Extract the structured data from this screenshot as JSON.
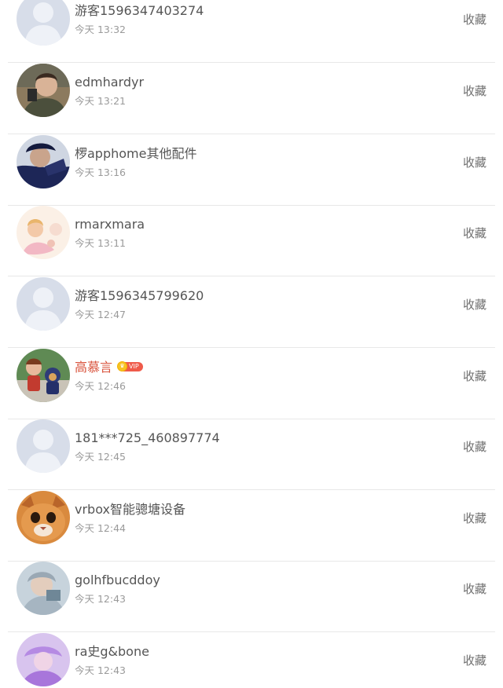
{
  "items": [
    {
      "name": "游客1596347403274",
      "time": "今天 13:32",
      "action": "收藏",
      "avatar": "default-avatar-icon"
    },
    {
      "name": "edmhardyr",
      "time": "今天 13:21",
      "action": "收藏",
      "avatar": "user-photo"
    },
    {
      "name": "椤apphome其他配件",
      "time": "今天 13:16",
      "action": "收藏",
      "avatar": "user-photo"
    },
    {
      "name": "rmarxmara",
      "time": "今天 13:11",
      "action": "收藏",
      "avatar": "user-photo"
    },
    {
      "name": "游客1596345799620",
      "time": "今天 12:47",
      "action": "收藏",
      "avatar": "default-avatar-icon"
    },
    {
      "name": "高慕言",
      "time": "今天 12:46",
      "action": "收藏",
      "avatar": "user-photo",
      "vip": "VIP"
    },
    {
      "name": "181***725_460897774",
      "time": "今天 12:45",
      "action": "收藏",
      "avatar": "default-avatar-icon"
    },
    {
      "name": "vrbox智能骢塘设备",
      "time": "今天 12:44",
      "action": "收藏",
      "avatar": "user-photo"
    },
    {
      "name": "golhfbucddoy",
      "time": "今天 12:43",
      "action": "收藏",
      "avatar": "user-photo"
    },
    {
      "name": "ra史g&bone",
      "time": "今天 12:43",
      "action": "收藏",
      "avatar": "user-photo"
    }
  ],
  "colors": {
    "name_text": "#555555",
    "vip_name_text": "#d9533c",
    "time_text": "#9a9a9a",
    "divider": "#e8e8e8",
    "default_avatar_bg": "#d7dde9"
  }
}
